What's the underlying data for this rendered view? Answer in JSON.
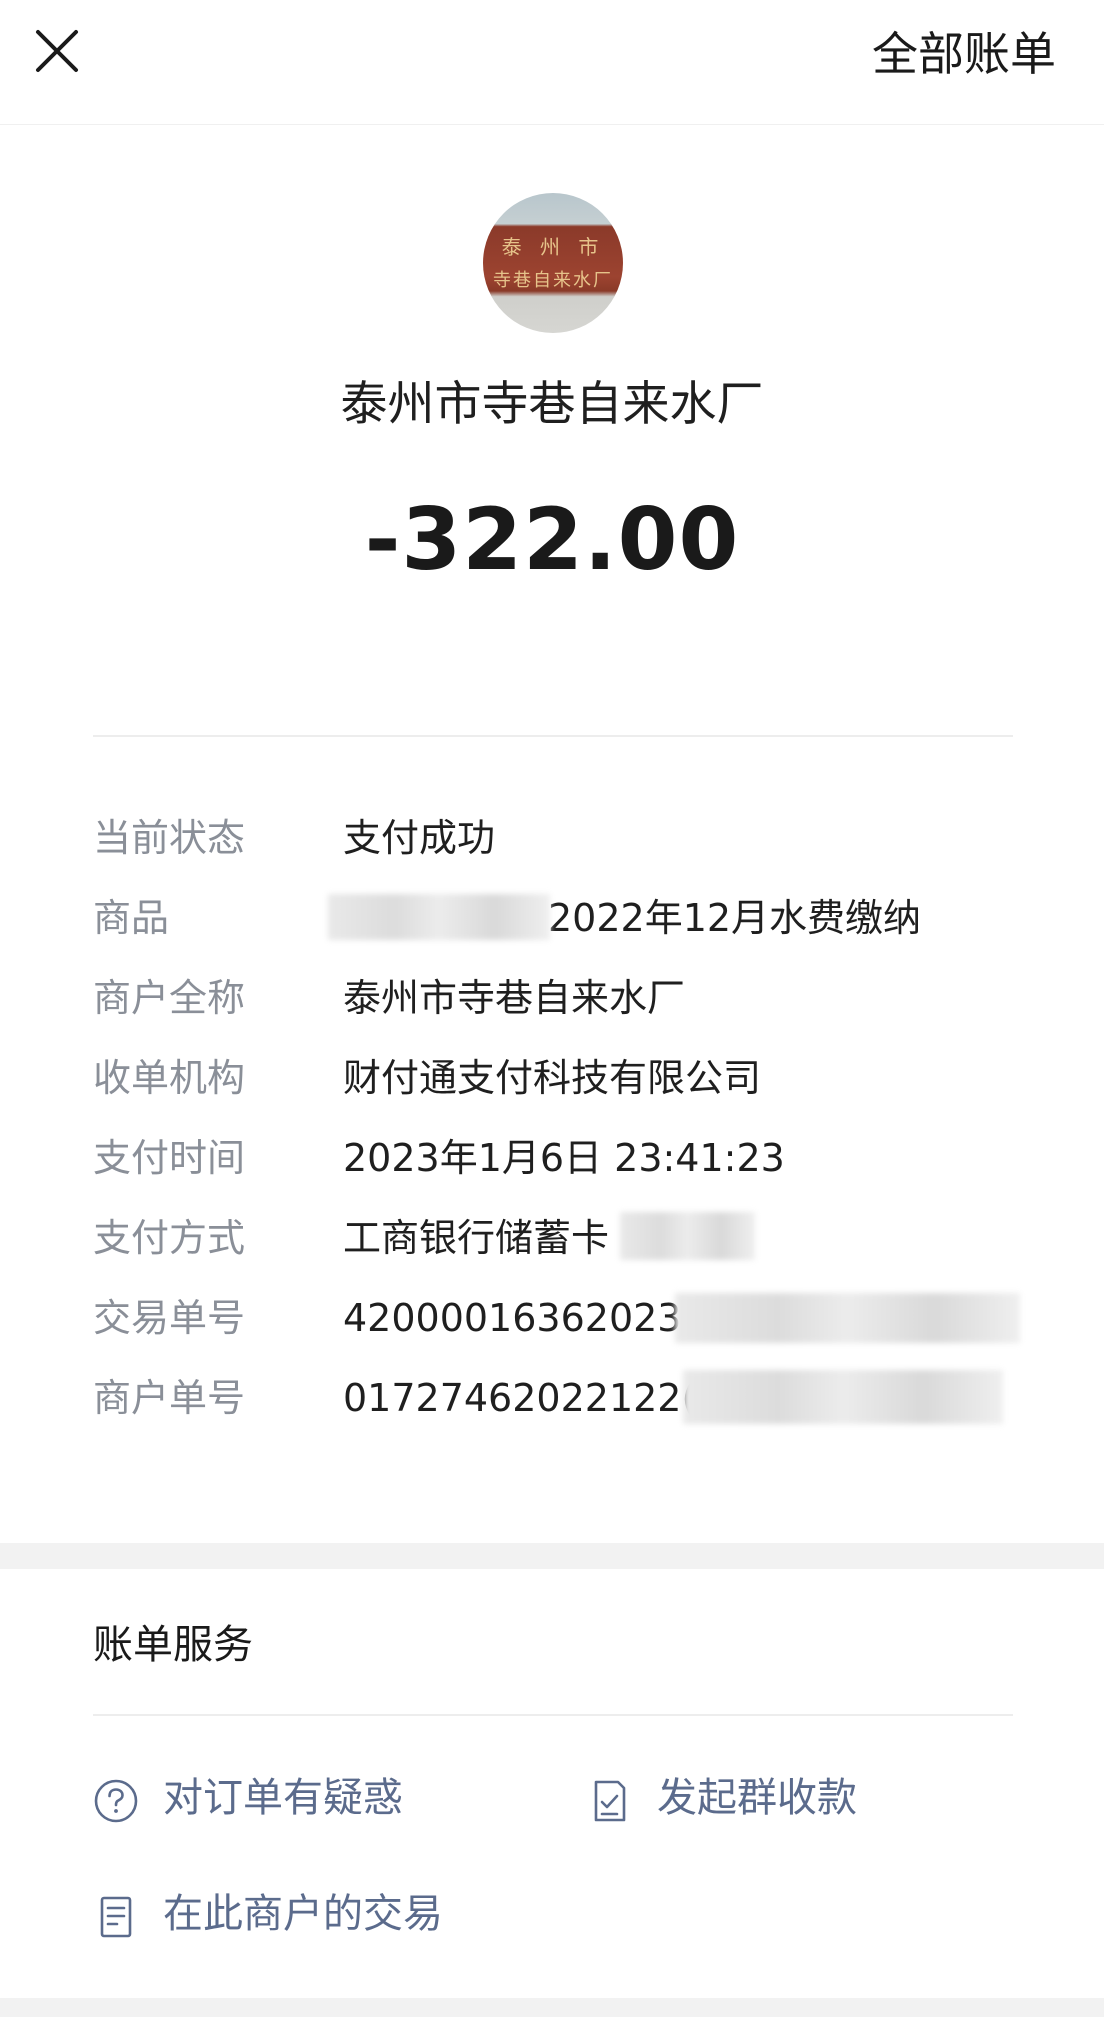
{
  "header": {
    "close_icon": "close-icon",
    "all_bills_label": "全部账单"
  },
  "merchant": {
    "avatar_icon": "merchant-avatar",
    "avatar_sign_line1": "泰 州 市",
    "avatar_sign_line2": "寺巷自来水厂",
    "name": "泰州市寺巷自来水厂",
    "amount": "-322.00"
  },
  "details": [
    {
      "label": "当前状态",
      "value": "支付成功"
    },
    {
      "label": "商品",
      "value": "2022年12月水费缴纳"
    },
    {
      "label": "商户全称",
      "value": "泰州市寺巷自来水厂"
    },
    {
      "label": "收单机构",
      "value": "财付通支付科技有限公司"
    },
    {
      "label": "支付时间",
      "value": "2023年1月6日 23:41:23"
    },
    {
      "label": "支付方式",
      "value": "工商银行储蓄卡"
    },
    {
      "label": "交易单号",
      "value": "42000016362023("
    },
    {
      "label": "商户单号",
      "value": "01727462022122("
    }
  ],
  "services": {
    "title": "账单服务",
    "items": [
      {
        "label": "对订单有疑惑",
        "icon": "question-circle-icon"
      },
      {
        "label": "发起群收款",
        "icon": "checklist-document-icon"
      },
      {
        "label": "在此商户的交易",
        "icon": "document-list-icon"
      }
    ]
  },
  "colors": {
    "label_gray": "#8a8f98",
    "link_blue_gray": "#5b6b8c",
    "section_gap": "#f2f2f2"
  }
}
